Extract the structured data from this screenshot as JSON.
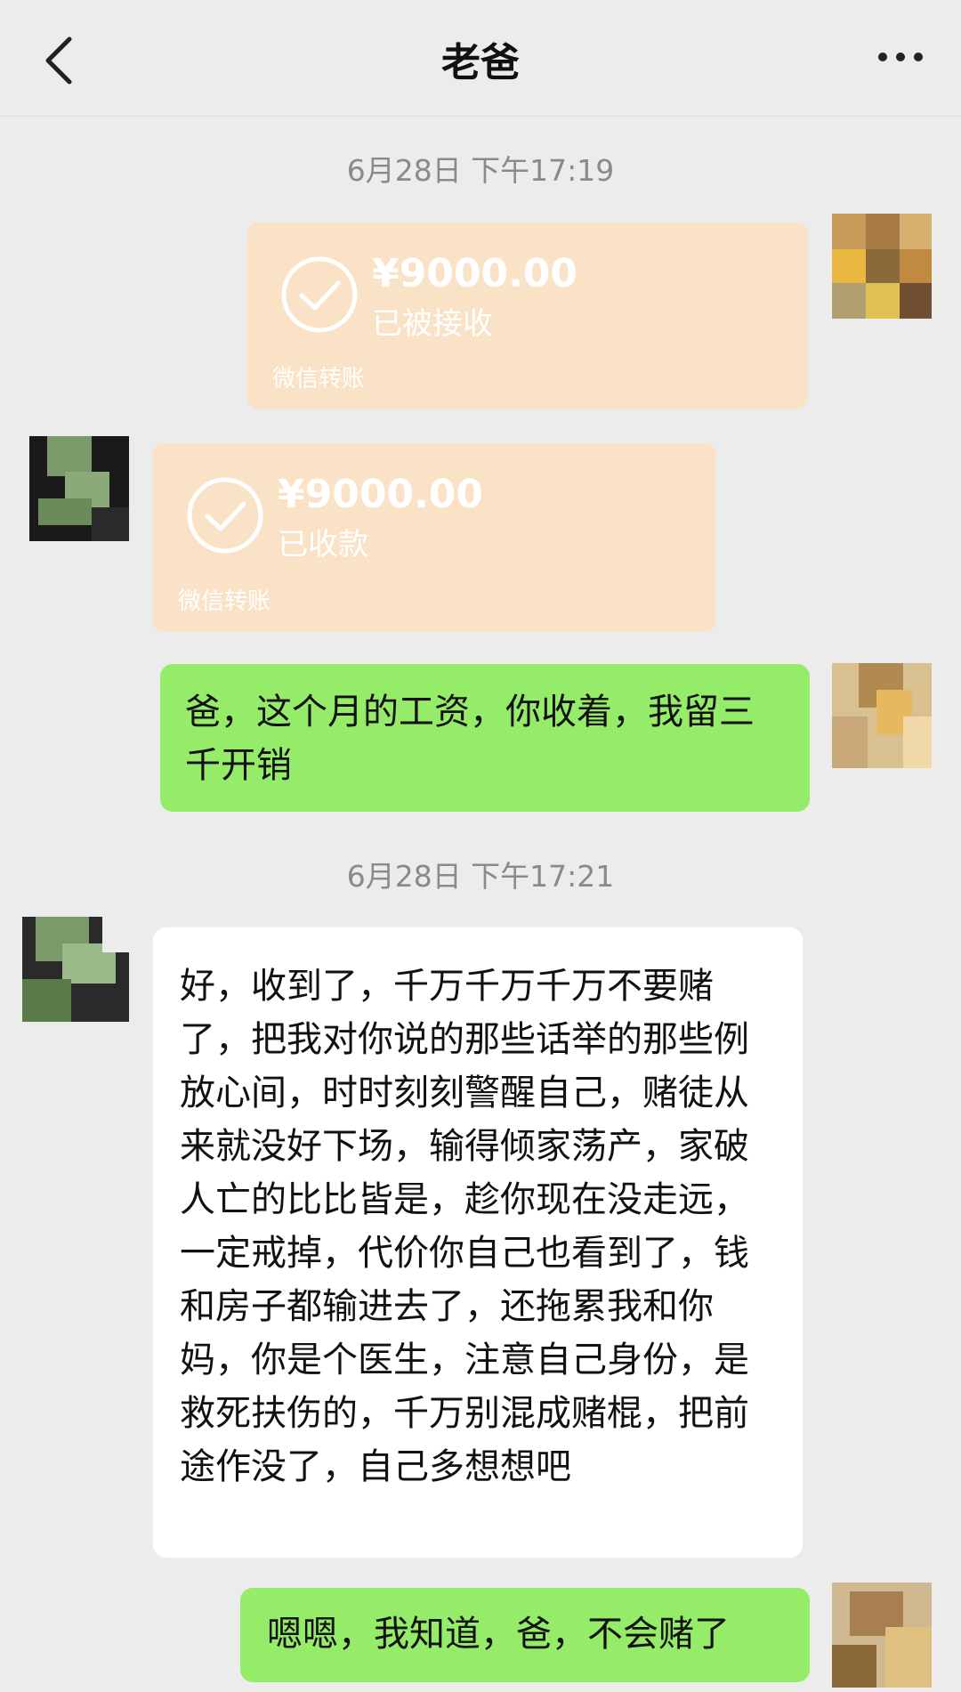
{
  "header": {
    "title": "老爸",
    "back_icon": "chevron-left-icon",
    "more_icon": "more-horizontal-icon"
  },
  "messages": {
    "timestamp_1": "6月28日 下午17:19",
    "transfer_sent": {
      "amount": "¥9000.00",
      "status": "已被接收",
      "label": "微信转账"
    },
    "transfer_received": {
      "amount": "¥9000.00",
      "status": "已收款",
      "label": "微信转账"
    },
    "msg_salary": "爸，这个月的工资，你收着，我留三千开销",
    "timestamp_2": "6月28日 下午17:21",
    "msg_father": "好，收到了，千万千万千万不要赌了，把我对你说的那些话举的那些例放心间，时时刻刻警醒自己，赌徒从来就没好下场，输得倾家荡产，家破人亡的比比皆是，趁你现在没走远，一定戒掉，代价你自己也看到了，钱和房子都输进去了，还拖累我和你妈，你是个医生，注意自己身份，是救死扶伤的，千万别混成赌棍，把前途作没了，自己多想想吧",
    "msg_reply": "嗯嗯，我知道，爸，不会赌了"
  },
  "colors": {
    "green_bubble": "#95ec69",
    "transfer_bg": "#fae2c7",
    "chat_bg": "#ececec"
  }
}
